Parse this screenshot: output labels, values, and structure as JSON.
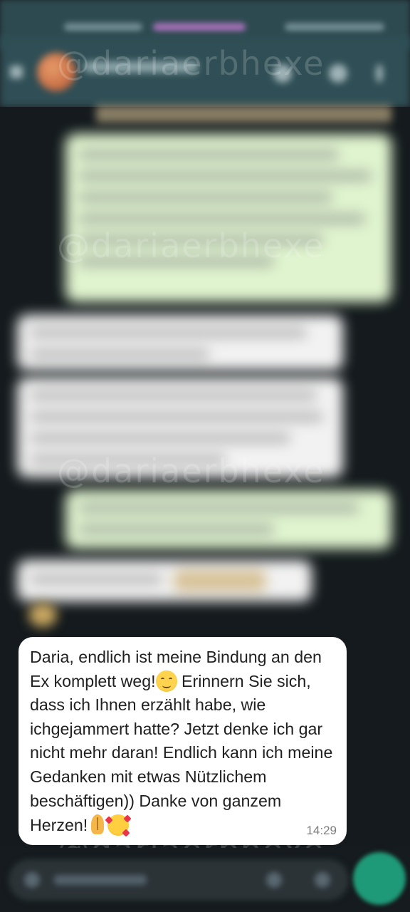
{
  "watermark": "@dariaerbhexe",
  "message": {
    "segments": {
      "s1": "Daria, endlich ist meine Bindung an den Ex komplett weg!",
      "s2": " Erinnern Sie sich, dass ich Ihnen erzählt habe, wie ichgejammert hatte? Jetzt denke ich gar nicht mehr daran! Endlich kann ich meine Gedanken mit etwas Nützlichem beschäftigen)) Danke von ganzem Herzen!"
    },
    "time": "14:29",
    "emoji_names": [
      "smiling-face-emoji",
      "folded-hands-emoji",
      "smiling-face-with-hearts-emoji"
    ]
  },
  "colors": {
    "header": "#2f4e55",
    "chat_background": "#141a1d",
    "outgoing_bubble": "#e0f4cf",
    "incoming_bubble": "#ffffff",
    "send_button": "#1f9a78"
  }
}
